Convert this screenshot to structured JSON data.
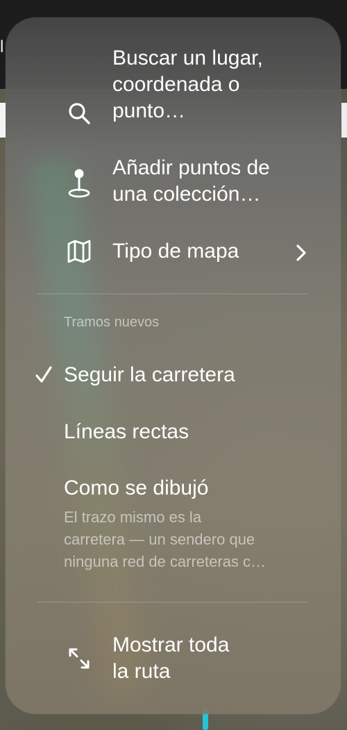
{
  "background": {
    "title_fragment": "l",
    "route_color": "#28c2d6"
  },
  "menu": {
    "items": [
      {
        "label": "Buscar un lugar,\ncoordenada o\npunto…",
        "icon": "search-icon"
      },
      {
        "label": "Añadir puntos de\nuna colección…",
        "icon": "pin-icon"
      },
      {
        "label": "Tipo de mapa",
        "icon": "map-icon",
        "has_submenu": true
      }
    ],
    "section_header": "Tramos nuevos",
    "options": [
      {
        "label": "Seguir la carretera",
        "selected": true
      },
      {
        "label": "Líneas rectas",
        "selected": false
      },
      {
        "label": "Como se dibujó",
        "selected": false,
        "description": "El trazo mismo es la\ncarretera — un sendero que\nninguna red de carreteras c…"
      }
    ],
    "footer": {
      "label": "Mostrar toda\nla ruta",
      "icon": "expand-icon"
    }
  }
}
